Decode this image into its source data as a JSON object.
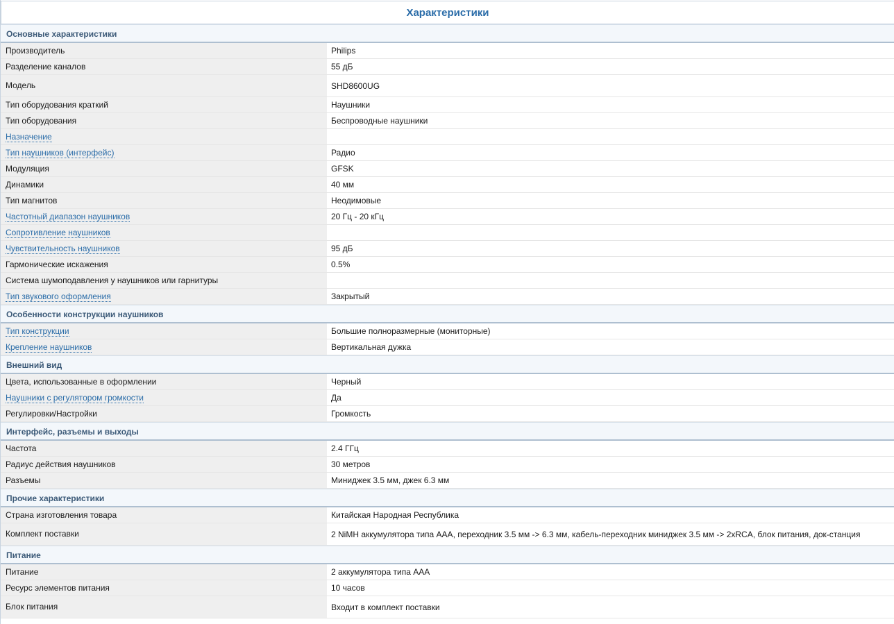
{
  "title": "Характеристики",
  "sections": [
    {
      "name": "Основные характеристики",
      "rows": [
        {
          "label": "Производитель",
          "value": "Philips"
        },
        {
          "label": "Разделение каналов",
          "value": "55 дБ"
        },
        {
          "label": "Модель",
          "value": "SHD8600UG"
        },
        {
          "label": "Тип оборудования краткий",
          "value": "Наушники"
        },
        {
          "label": "Тип оборудования",
          "value": "Беспроводные наушники"
        },
        {
          "label": "Назначение",
          "value": ""
        },
        {
          "label": "Тип наушников (интерфейс)",
          "value": "Радио"
        },
        {
          "label": "Модуляция",
          "value": "GFSK"
        },
        {
          "label": "Динамики",
          "value": "40 мм"
        },
        {
          "label": "Тип магнитов",
          "value": "Неодимовые"
        },
        {
          "label": "Частотный диапазон наушников",
          "value": "20 Гц - 20 кГц"
        },
        {
          "label": "Сопротивление наушников",
          "value": ""
        },
        {
          "label": "Чувствительность наушников",
          "value": "95 дБ"
        },
        {
          "label": "Гармонические искажения",
          "value": "0.5%"
        },
        {
          "label": "Система шумоподавления у наушников или гарнитуры",
          "value": ""
        },
        {
          "label": "Тип звукового оформления",
          "value": "Закрытый"
        }
      ]
    },
    {
      "name": "Особенности конструкции наушников",
      "rows": [
        {
          "label": "Тип конструкции",
          "value": "Большие полноразмерные (мониторные)"
        },
        {
          "label": "Крепление наушников",
          "value": "Вертикальная дужка"
        }
      ]
    },
    {
      "name": "Внешний вид",
      "rows": [
        {
          "label": "Цвета, использованные в оформлении",
          "value": "Черный"
        },
        {
          "label": "Наушники с регулятором громкости",
          "value": "Да"
        },
        {
          "label": "Регулировки/Настройки",
          "value": "Громкость"
        }
      ]
    },
    {
      "name": "Интерфейс, разъемы и выходы",
      "rows": [
        {
          "label": "Частота",
          "value": "2.4 ГГц"
        },
        {
          "label": "Радиус действия наушников",
          "value": "30 метров"
        },
        {
          "label": "Разъемы",
          "value": "Миниджек 3.5 мм, джек 6.3 мм"
        }
      ]
    },
    {
      "name": "Прочие характеристики",
      "rows": [
        {
          "label": "Страна изготовления товара",
          "value": "Китайская Народная Республика"
        },
        {
          "label": "Комплект поставки",
          "value": "2 NiMH аккумулятора типа AAA, переходник 3.5 мм -> 6.3 мм, кабель-переходник миниджек 3.5 мм -> 2xRCA, блок питания, док-станция"
        }
      ]
    },
    {
      "name": "Питание",
      "rows": [
        {
          "label": "Питание",
          "value": "2 аккумулятора типа AAA"
        },
        {
          "label": "Ресурс элементов питания",
          "value": "10 часов"
        },
        {
          "label": "Блок питания",
          "value": "Входит в комплект поставки"
        }
      ]
    }
  ],
  "colors": {
    "title_blue": "#2a6ca8",
    "section_text": "#3c5a78",
    "label_bg": "#efefef",
    "link_blue": "#2a6ca8"
  }
}
